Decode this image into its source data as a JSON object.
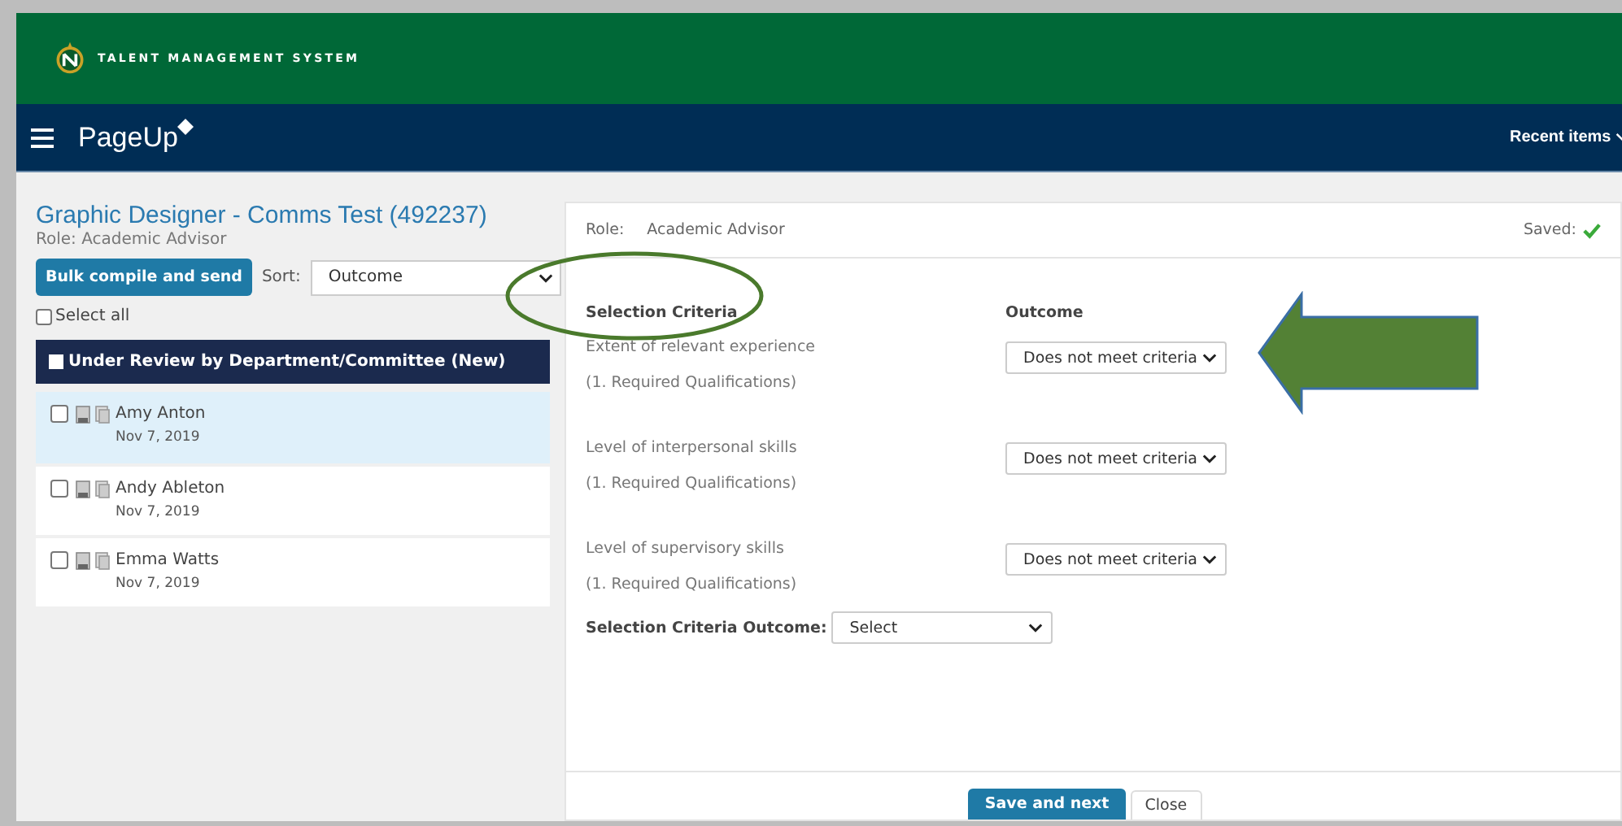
{
  "header": {
    "title": "TALENT MANAGEMENT SYSTEM"
  },
  "nav": {
    "brand": "PageUp",
    "recent": "Recent items"
  },
  "job": {
    "title": "Graphic Designer - Comms Test (492237)",
    "role": "Role: Academic Advisor"
  },
  "bulk_button": "Bulk compile and send",
  "sort": {
    "label": "Sort:",
    "value": "Outcome"
  },
  "select_all": {
    "label": "Select all",
    "checked": false
  },
  "group": {
    "label": "Under Review by Department/Committee (New)",
    "checked": false
  },
  "candidates": [
    {
      "name": "Amy Anton",
      "date": "Nov 7, 2019",
      "selected": true,
      "checked": false
    },
    {
      "name": "Andy Ableton",
      "date": "Nov 7, 2019",
      "selected": false,
      "checked": false
    },
    {
      "name": "Emma Watts",
      "date": "Nov 7, 2019",
      "selected": false,
      "checked": false
    }
  ],
  "detail": {
    "role_label": "Role:",
    "role": "Academic Advisor",
    "saved": "Saved:",
    "criteria_heading": "Selection Criteria",
    "outcome_heading": "Outcome",
    "criteria": [
      {
        "name": "Extent of relevant experience",
        "category": "(1. Required Qualifications)",
        "outcome": "Does not meet criteria"
      },
      {
        "name": "Level of interpersonal skills",
        "category": "(1. Required Qualifications)",
        "outcome": "Does not meet criteria"
      },
      {
        "name": "Level of supervisory skills",
        "category": "(1. Required Qualifications)",
        "outcome": "Does not meet criteria"
      }
    ],
    "overall_label": "Selection Criteria Outcome:",
    "overall_value": "Select"
  },
  "actions": [
    {
      "label": "Save and next",
      "kind": "primary"
    },
    {
      "label": "Close",
      "kind": "secondary"
    }
  ]
}
